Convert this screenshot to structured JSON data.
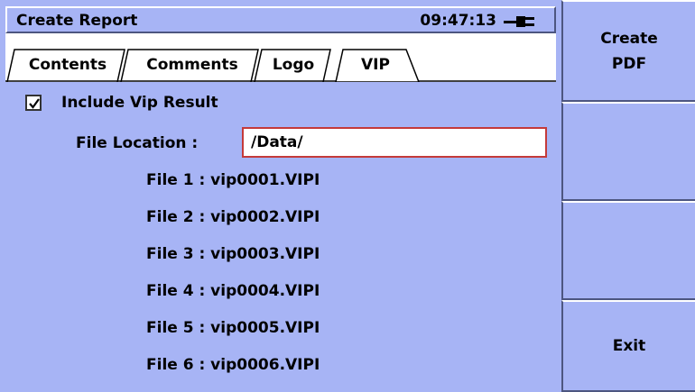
{
  "header": {
    "title": "Create Report",
    "time": "09:47:13",
    "power_icon": "plug-icon"
  },
  "tabs": [
    {
      "label": "Contents",
      "active": false
    },
    {
      "label": "Comments",
      "active": false
    },
    {
      "label": "Logo",
      "active": false
    },
    {
      "label": "VIP",
      "active": true
    }
  ],
  "vip": {
    "include_checked": true,
    "include_label": "Include Vip Result",
    "location_label": "File Location :",
    "location_value": "/Data/",
    "files": [
      "File 1 : vip0001.VIPI",
      "File 2 : vip0002.VIPI",
      "File 3 : vip0003.VIPI",
      "File 4 : vip0004.VIPI",
      "File 5 : vip0005.VIPI",
      "File 6 : vip0006.VIPI"
    ]
  },
  "softkeys": {
    "create_pdf_line1": "Create",
    "create_pdf_line2": "PDF",
    "exit": "Exit"
  }
}
